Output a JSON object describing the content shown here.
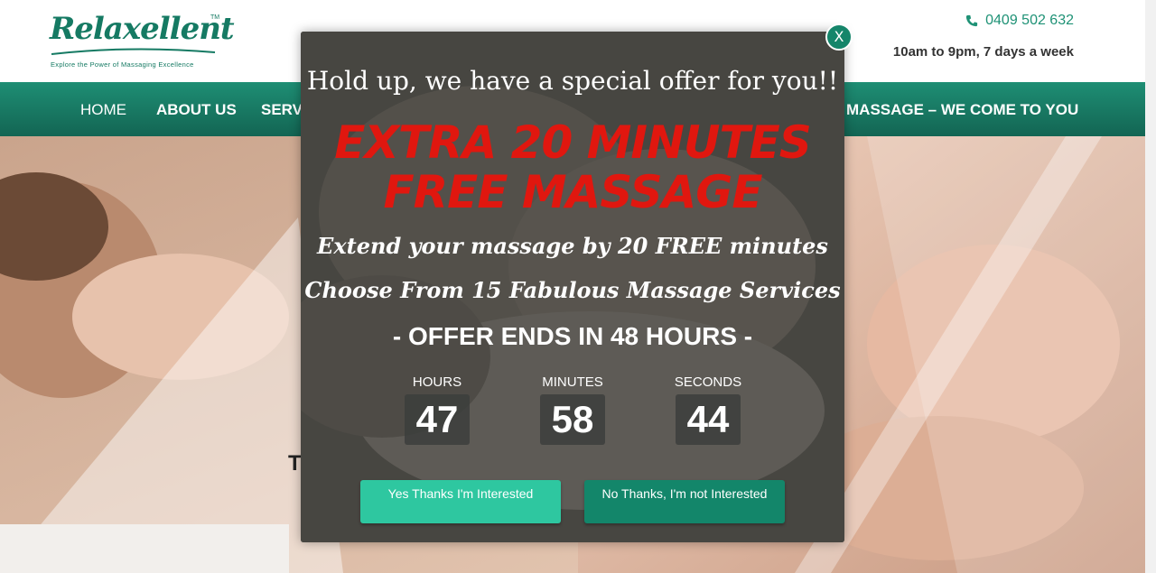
{
  "header": {
    "logo_text": "Relaxellent",
    "logo_tm": "TM",
    "logo_tagline": "Explore the Power of Massaging Excellence",
    "phone": "0409 502 632",
    "phone_icon": "phone-icon",
    "hours": "10am to 9pm, 7 days a week"
  },
  "nav": {
    "home": "HOME",
    "about": "ABOUT US",
    "services": "SERVI",
    "mobile": "MASSAGE – WE COME TO YOU"
  },
  "hero": {
    "caption_fragment": "T"
  },
  "popup": {
    "close_label": "X",
    "headline": "Hold up, we have a special offer for you!!",
    "offer": "EXTRA 20 MINUTES FREE MASSAGE",
    "extend": "Extend your massage by 20 FREE minutes",
    "choose": "Choose From 15 Fabulous Massage Services",
    "ends": "- OFFER ENDS IN 48 HOURS -",
    "countdown": {
      "hours_label": "HOURS",
      "hours": "47",
      "minutes_label": "MINUTES",
      "minutes": "58",
      "seconds_label": "SECONDS",
      "seconds": "44"
    },
    "yes_button": "Yes Thanks I'm Interested",
    "no_button": "No Thanks, I'm not Interested"
  },
  "colors": {
    "brand_green": "#157a63",
    "nav_green": "#1e8e74",
    "offer_red": "#e0170f",
    "yes_button": "#2ec7a0",
    "no_button": "#13866a"
  }
}
